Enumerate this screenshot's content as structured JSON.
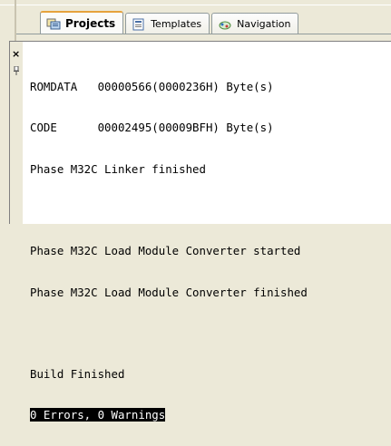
{
  "tabs": [
    {
      "label": "Projects",
      "icon": "projects-icon",
      "active": true
    },
    {
      "label": "Templates",
      "icon": "templates-icon",
      "active": false
    },
    {
      "label": "Navigation",
      "icon": "navigation-icon",
      "active": false
    }
  ],
  "output": {
    "lines": [
      "ROMDATA   00000566(0000236H) Byte(s)",
      "CODE      00002495(00009BFH) Byte(s)",
      "Phase M32C Linker finished",
      "",
      "Phase M32C Load Module Converter started",
      "Phase M32C Load Module Converter finished",
      "",
      "Build Finished",
      "0 Errors, 0 Warnings"
    ],
    "highlighted_line": "0 Errors, 0 Warnings"
  },
  "colors": {
    "tab_active_accent": "#e6a23c",
    "window_bg": "#ece9d8",
    "highlight_bg": "#000000"
  }
}
